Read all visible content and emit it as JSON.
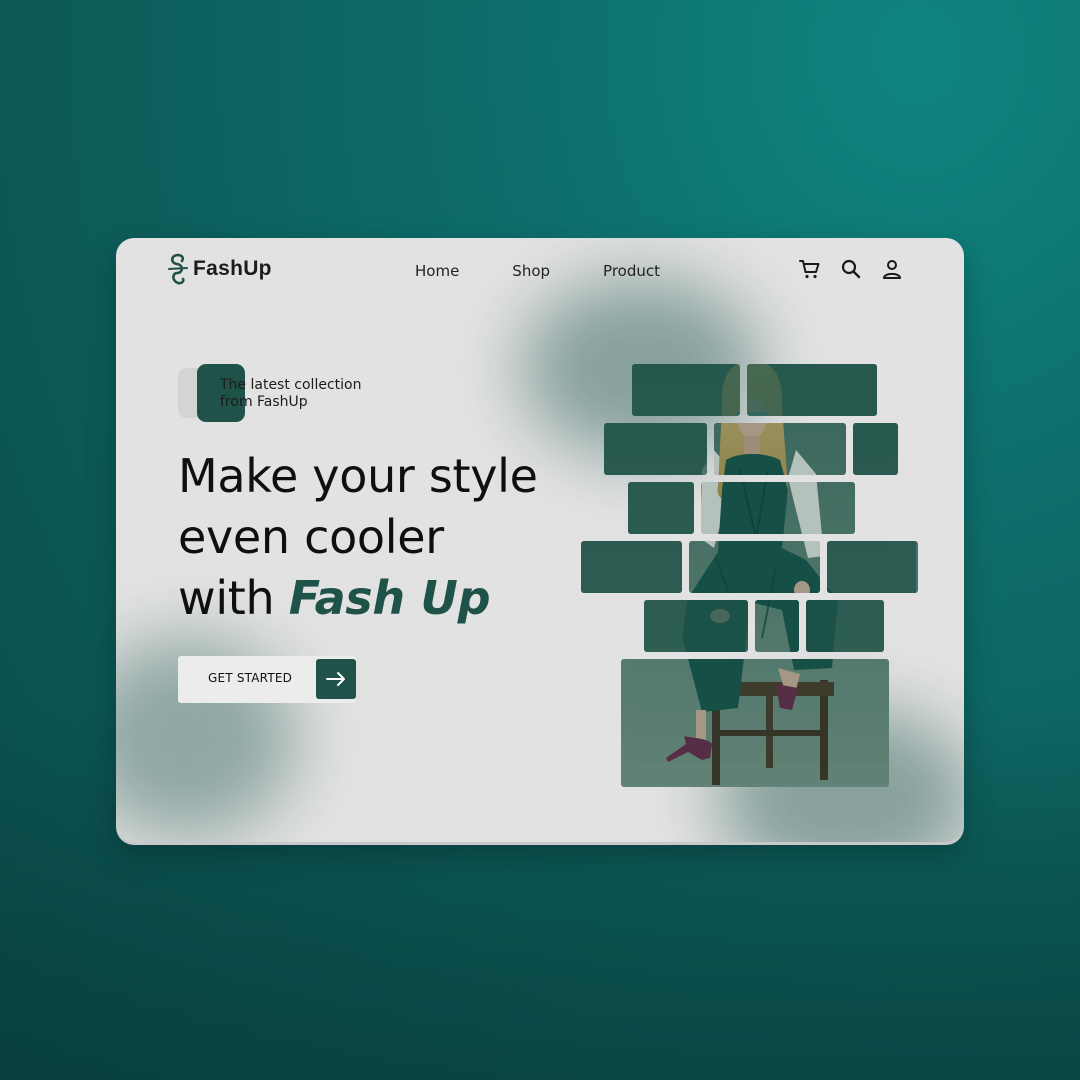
{
  "brand": {
    "name": "FashUp"
  },
  "nav": {
    "items": [
      "Home",
      "Shop",
      "Product"
    ]
  },
  "header_icons": [
    "cart-icon",
    "search-icon",
    "user-icon"
  ],
  "hero": {
    "tag_line1": "The latest collection",
    "tag_line2": "from FashUp",
    "headline_line1": "Make your style",
    "headline_line2": "even cooler",
    "headline_prefix": "with ",
    "headline_brand": "Fash Up",
    "cta_label": "GET STARTED"
  },
  "colors": {
    "accent": "#1f5248",
    "card_background": "#e2e2e2",
    "page_background": "#0e6f6c"
  }
}
